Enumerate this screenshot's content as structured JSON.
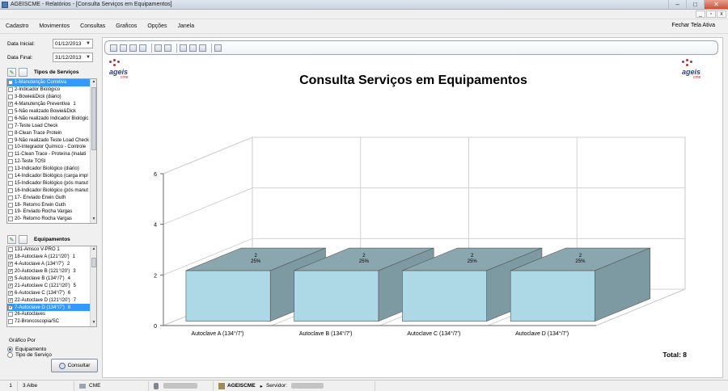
{
  "window": {
    "title": "AGEISCME - Relatórios - [Consulta Serviços em Equipamentos]",
    "minimize": "–",
    "maximize": "□",
    "close": "✕"
  },
  "mdi": {
    "min": "_",
    "restore": "▫",
    "close": "x"
  },
  "menu": {
    "items": [
      "Cadastro",
      "Movimentos",
      "Consultas",
      "Graficos",
      "Opções",
      "Janela"
    ],
    "right": "Fechar Tela Ativa"
  },
  "filters": {
    "data_inicial_label": "Data Inicial:",
    "data_inicial": "01/12/2013",
    "data_final_label": "Data Final:",
    "data_final": "31/12/2013"
  },
  "servicos": {
    "title": "Tipos de Serviços",
    "items": [
      {
        "label": "1-Manutenção Corretiva",
        "checked": false,
        "selected": true,
        "count": ""
      },
      {
        "label": "2-Indicador Biológico",
        "checked": false,
        "selected": false,
        "count": ""
      },
      {
        "label": "3-Bowie&Dick (diário)",
        "checked": false,
        "selected": false,
        "count": ""
      },
      {
        "label": "4-Manutenção Preventiva",
        "checked": true,
        "selected": false,
        "count": "1"
      },
      {
        "label": "5-Não realizado Bowie&Dick",
        "checked": false,
        "selected": false,
        "count": ""
      },
      {
        "label": "6-Não realizado Indicador Biológic",
        "checked": false,
        "selected": false,
        "count": ""
      },
      {
        "label": "7-Teste Load Check",
        "checked": false,
        "selected": false,
        "count": ""
      },
      {
        "label": "8-Clean Trace Protein",
        "checked": false,
        "selected": false,
        "count": ""
      },
      {
        "label": "9-Não realizado Teste Load Check",
        "checked": false,
        "selected": false,
        "count": ""
      },
      {
        "label": "10-Integrador Químico - Controle",
        "checked": false,
        "selected": false,
        "count": ""
      },
      {
        "label": "11-Clean Trace - Proteína (Inalati",
        "checked": false,
        "selected": false,
        "count": ""
      },
      {
        "label": "12-Teste TOSI",
        "checked": false,
        "selected": false,
        "count": ""
      },
      {
        "label": "13-Indicador Biológico (diário)",
        "checked": false,
        "selected": false,
        "count": ""
      },
      {
        "label": "14-Indicador Biológico (carga impl",
        "checked": false,
        "selected": false,
        "count": ""
      },
      {
        "label": "15-Indicador Biológico (pós manut",
        "checked": false,
        "selected": false,
        "count": ""
      },
      {
        "label": "16-Indicador Biológico (pós manut",
        "checked": false,
        "selected": false,
        "count": ""
      },
      {
        "label": "17- Enviado Erwin Guth",
        "checked": false,
        "selected": false,
        "count": ""
      },
      {
        "label": "18- Retorno Erwin Guth",
        "checked": false,
        "selected": false,
        "count": ""
      },
      {
        "label": "19- Enviado Rocha Vargas",
        "checked": false,
        "selected": false,
        "count": ""
      },
      {
        "label": "20- Retorno Rocha Vargas",
        "checked": false,
        "selected": false,
        "count": ""
      }
    ]
  },
  "equipamentos": {
    "title": "Equipamentos",
    "items": [
      {
        "label": "131-Amsco V-PRO 1",
        "checked": false,
        "selected": false,
        "count": ""
      },
      {
        "label": "18-Autoclave A (121°/20')",
        "checked": true,
        "selected": false,
        "count": "1"
      },
      {
        "label": "4-Autoclave A (134°/7')",
        "checked": true,
        "selected": false,
        "count": "2"
      },
      {
        "label": "20-Autoclave B (121°/20')",
        "checked": true,
        "selected": false,
        "count": "3"
      },
      {
        "label": "5-Autoclave B (134°/7')",
        "checked": true,
        "selected": false,
        "count": "4"
      },
      {
        "label": "21-Autoclave C (121°/20')",
        "checked": true,
        "selected": false,
        "count": "5"
      },
      {
        "label": "6-Autoclave C (134°/7')",
        "checked": true,
        "selected": false,
        "count": "6"
      },
      {
        "label": "22-Autoclave D (121°/20')",
        "checked": true,
        "selected": false,
        "count": "7"
      },
      {
        "label": "7-Autoclave D (134°/7')",
        "checked": true,
        "selected": true,
        "count": "8"
      },
      {
        "label": "26-Autoclaves",
        "checked": false,
        "selected": false,
        "count": ""
      },
      {
        "label": "72-Broncoscopia/SC",
        "checked": false,
        "selected": false,
        "count": ""
      }
    ]
  },
  "grafico_por": {
    "label": "Gráfico Por",
    "options": [
      "Equipamento",
      "Tipo de Serviço"
    ],
    "selected": 0
  },
  "consultar_label": "Consultar",
  "logo": {
    "word": "ageis",
    "sub": "cme"
  },
  "chart_data": {
    "type": "bar",
    "title": "Consulta Serviços em Equipamentos",
    "categories": [
      "Autoclave A (134°/7')",
      "Autoclave B (134°/7')",
      "Autoclave C (134°/7')",
      "Autoclave D (134°/7')"
    ],
    "values": [
      2,
      2,
      2,
      2
    ],
    "data_labels": [
      "25%",
      "25%",
      "25%",
      "25%"
    ],
    "ylim": [
      0,
      6
    ],
    "yticks": [
      0,
      2,
      4,
      6
    ],
    "grid": true,
    "style": "3d",
    "bar_color": "#add8e6"
  },
  "total": "Total: 8",
  "statusbar": {
    "page": "1",
    "user_code": "3 Albe",
    "sector": "CME",
    "system": "AGEISCME",
    "server_label": "Servidor:"
  }
}
